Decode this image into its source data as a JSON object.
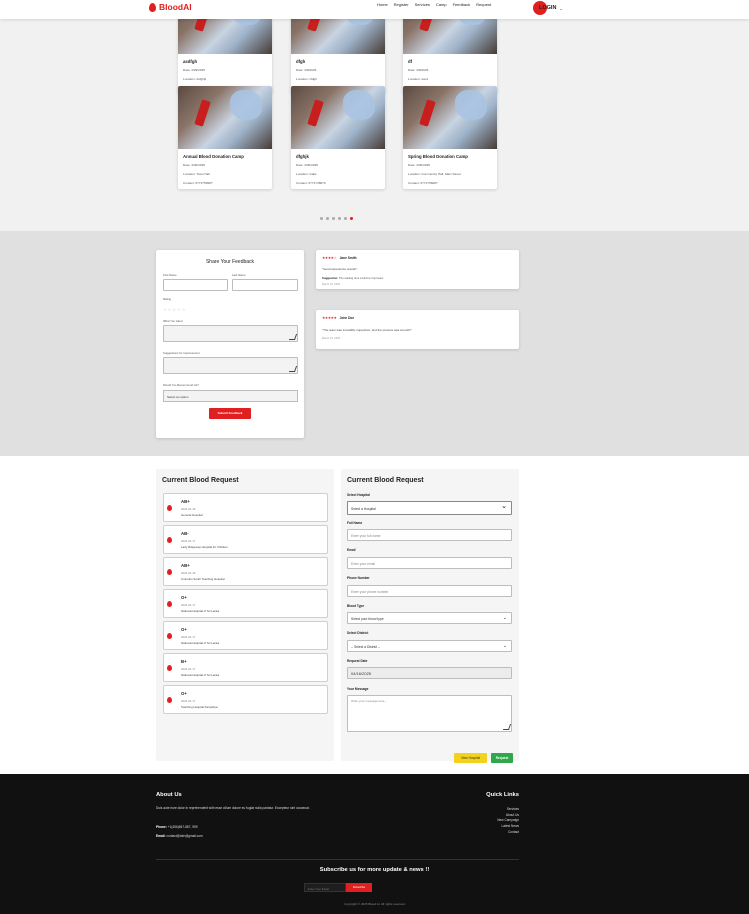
{
  "header": {
    "logo": "BloodAI",
    "nav": [
      "Home",
      "Register",
      "Services",
      "Camp",
      "Feedback",
      "Request"
    ],
    "login": "LOGIN"
  },
  "camps": {
    "row1": [
      {
        "title": "asdfgh",
        "date": "Date: 4/29/2025",
        "location": "Location: dsfghjk",
        "contact": "Contact: 234567"
      },
      {
        "title": "dfgh",
        "date": "Date: 4/9/2025",
        "location": "Location: sfdgh",
        "contact": "Contact: 0786787079"
      },
      {
        "title": "df",
        "date": "Date: 4/9/2025",
        "location": "Location: werd",
        "contact": "Contact: 0786787079"
      }
    ],
    "row2": [
      {
        "title": "Annual Blood Donation Camp",
        "date": "Date: 4/30/2025",
        "location": "Location: Town Hall",
        "contact": "Contact: 0771756987"
      },
      {
        "title": "dfghjk",
        "date": "Date: 4/30/2025",
        "location": "Location: Galle",
        "contact": "Contact: 0771745870"
      },
      {
        "title": "Spring Blood Donation Camp",
        "date": "Date: 4/30/2025",
        "location": "Location: Community Hall, Main Street",
        "contact": "Contact: 0771756987"
      }
    ]
  },
  "feedback": {
    "title": "Share Your Feedback",
    "first_name": "First Name",
    "last_name": "Last Name",
    "rating": "Rating",
    "stars": "☆ ☆ ☆ ☆ ☆",
    "what_you_liked": "What You Liked",
    "suggestions": "Suggestions for Improvement",
    "recommend": "Would You Recommend Us?",
    "recommend_placeholder": "Select an option",
    "submit": "Submit Feedback",
    "reviews": [
      {
        "stars": "★★★★☆",
        "name": "Jane Smith",
        "text": "\"Good experience overall.\"",
        "suggestion_label": "Suggestion:",
        "suggestion": "The waiting time could be improved.",
        "date": "March 15, 2025"
      },
      {
        "stars": "★★★★★",
        "name": "John Doe",
        "text": "\"The team was incredibly supportive, and the process was smooth!\"",
        "date": "March 10, 2025"
      }
    ]
  },
  "requests": {
    "list_title": "Current Blood Request",
    "items": [
      {
        "type": "AB+",
        "date": "2025-04-18",
        "hospital": "General Hospital"
      },
      {
        "type": "AB-",
        "date": "2025-04-17",
        "hospital": "Lady Ridgeway Hospital for Children"
      },
      {
        "type": "AB+",
        "date": "2025-04-18",
        "hospital": "Colombo South Teaching Hospital"
      },
      {
        "type": "O+",
        "date": "2025-04-17",
        "hospital": "National Hospital of Sri Lanka"
      },
      {
        "type": "O+",
        "date": "2025-04-17",
        "hospital": "National Hospital of Sri Lanka"
      },
      {
        "type": "B+",
        "date": "2025-04-17",
        "hospital": "National Hospital of Sri Lanka"
      },
      {
        "type": "O+",
        "date": "2025-04-17",
        "hospital": "Teaching Hospital Karapitiya"
      }
    ],
    "form": {
      "title": "Current Blood Request",
      "hospital_label": "Select Hospital",
      "hospital_value": "Select a Hospital",
      "fullname_label": "Full Name",
      "fullname_placeholder": "Enter your full name",
      "email_label": "Email",
      "email_placeholder": "Enter your email",
      "phone_label": "Phone Number",
      "phone_placeholder": "Enter your phone number",
      "bloodtype_label": "Blood Type",
      "bloodtype_value": "Select your blood type",
      "district_label": "Select District",
      "district_value": "-- Select a District --",
      "date_label": "Request Date",
      "date_value": "04/16/2025",
      "message_label": "Your Message",
      "message_placeholder": "Write your message here...",
      "view_hospital": "View Hospital",
      "request": "Request"
    }
  },
  "footer": {
    "about_title": "About Us",
    "about_text": "Duis aute irure dolor in reprehenderit with esse cillum dolore eu fugiat nulla pariatur. Excepteur sint occaecat.",
    "phone_label": "Phone:",
    "phone_value": "+1(456)657-887, 999",
    "email_label": "Email:",
    "email_value": "contact@site@gmail.com",
    "quick_title": "Quick Links",
    "links": [
      "Services",
      "About Us",
      "New Campaign",
      "Latest News",
      "Contact"
    ],
    "subscribe_title": "Subscribe us for more update & news !!",
    "subscribe_placeholder": "Enter Your Email",
    "subscribe_button": "Subscribe",
    "copyright": "Copyright © 2025 Blood Ai. All rights reserved"
  }
}
